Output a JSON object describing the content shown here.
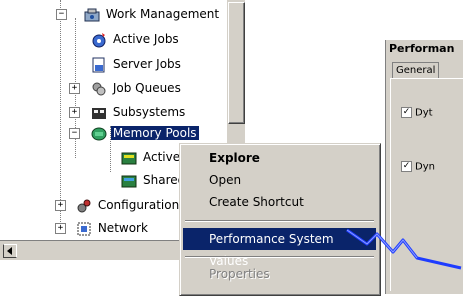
{
  "tree": {
    "items": [
      {
        "label": "Work Management",
        "icon": "work-management-icon",
        "expander": "−"
      },
      {
        "label": "Active Jobs",
        "icon": "active-jobs-icon"
      },
      {
        "label": "Server Jobs",
        "icon": "server-jobs-icon"
      },
      {
        "label": "Job Queues",
        "icon": "job-queues-icon",
        "expander": "+"
      },
      {
        "label": "Subsystems",
        "icon": "subsystems-icon",
        "expander": "+"
      },
      {
        "label": "Memory Pools",
        "icon": "memory-pools-icon",
        "expander": "−",
        "selected": true
      },
      {
        "label": "Active Po",
        "icon": "active-pools-icon"
      },
      {
        "label": "Shared Po",
        "icon": "shared-pools-icon"
      },
      {
        "label": "Configuration and",
        "icon": "configuration-icon",
        "expander": "+"
      },
      {
        "label": "Network",
        "icon": "network-icon",
        "expander": "+"
      }
    ]
  },
  "context_menu": {
    "items": [
      {
        "label": "Explore",
        "style": "bold"
      },
      {
        "label": "Open"
      },
      {
        "label": "Create Shortcut"
      },
      {
        "label": "Performance System Values",
        "highlighted": true
      },
      {
        "label": "Properties",
        "disabled": true
      }
    ]
  },
  "dialog": {
    "title": "Performan",
    "tab": "General",
    "checkboxes": [
      {
        "label": "Dyt",
        "checked": true
      },
      {
        "label": "Dyn",
        "checked": true
      }
    ]
  },
  "colors": {
    "selection": "#0a246a",
    "face": "#d4d0c8",
    "bolt": "#1e3cff"
  }
}
